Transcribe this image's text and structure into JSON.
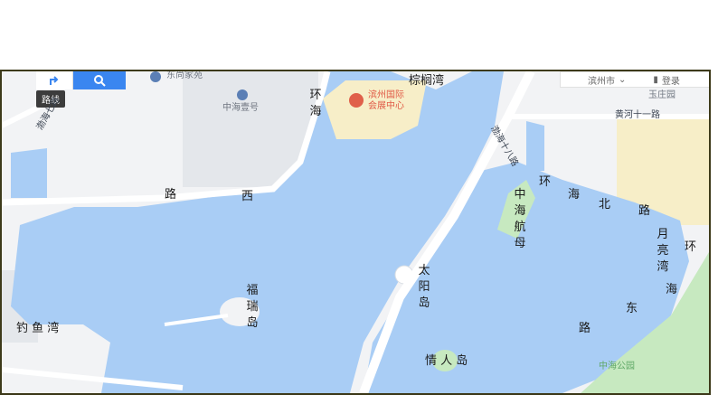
{
  "toolbar": {
    "route_label": "路线",
    "route_icon": "route-icon",
    "search_icon": "search-icon",
    "city": "滨州市",
    "city_chevron": "chevron-down-icon",
    "login": "登录"
  },
  "places": {
    "binzhou_center": "滨州国际\n会展中心",
    "dongshang": "东尚家苑",
    "zhonghai_yihao": "中海壹号",
    "yuzhuang": "玉庄园",
    "zhonghai_park": "中海公园"
  },
  "roads": {
    "huanhai_west_v": "环海",
    "huanhai_west_h1": "路",
    "huanhai_west_h2": "西",
    "bohai_18": "渤海十八路",
    "huanghe_11": "黄河十一路",
    "bohai_left": "渤海七路",
    "huanhai_north": [
      "环",
      "海",
      "北",
      "路"
    ],
    "huanhai_east": [
      "环",
      "海",
      "东",
      "路"
    ]
  },
  "water": {
    "zonglv_wan": "棕榈湾",
    "diaoyu_wan": "钓 鱼 湾",
    "yueliang_wan": "月\n亮\n湾"
  },
  "islands": {
    "furui": "福\n瑞\n岛",
    "taiyang": "太\n阳\n岛",
    "zhonghai_hangmu": "中\n海\n航\n母",
    "qingren": "情 人 岛"
  },
  "colors": {
    "water": "#a9cdf5",
    "land": "#f2f3f5",
    "block": "#e2e6ea",
    "green": "#c7e9c0",
    "road": "#ffffff",
    "yellow": "#f7eec8",
    "accent": "#3a86f0"
  }
}
